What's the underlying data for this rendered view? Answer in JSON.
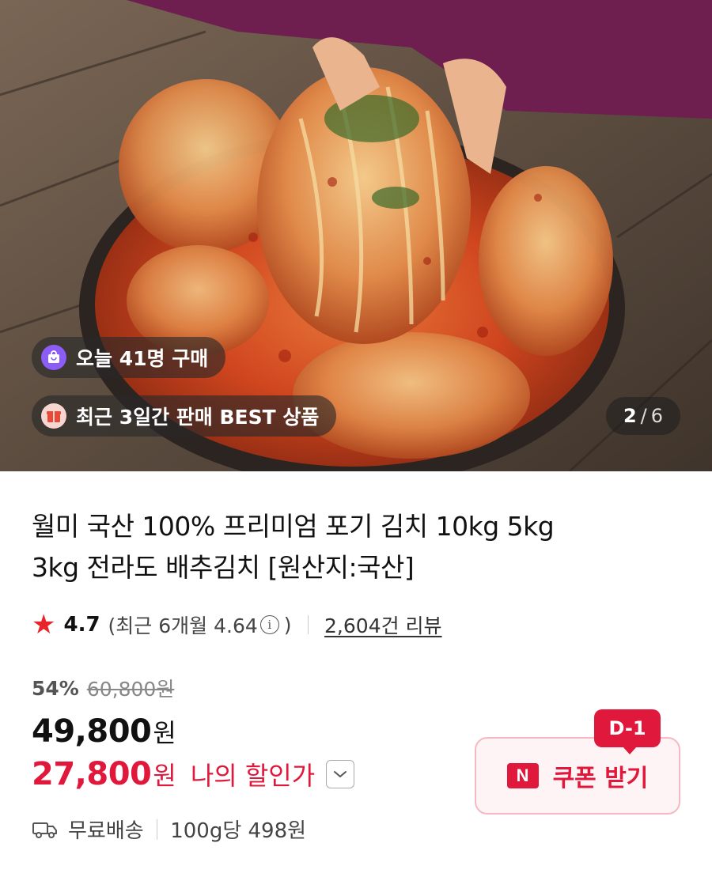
{
  "hero": {
    "image_alt": "kimchi photo",
    "badges": [
      {
        "icon": "shopping-bag-icon",
        "text": "오늘 41명 구매"
      },
      {
        "icon": "gift-box-icon",
        "text": "최근 3일간 판매 BEST 상품"
      }
    ],
    "counter": {
      "current": "2",
      "separator": "/",
      "total": "6"
    }
  },
  "product": {
    "title_line1": "월미 국산 100% 프리미엄 포기 김치 10kg 5kg",
    "title_line2": "3kg 전라도 배추김치 [원산지:국산]",
    "rating": {
      "score": "4.7",
      "recent_prefix": "(최근 6개월 4.64",
      "recent_suffix": ")",
      "info_icon": "i",
      "reviews": "2,604건 리뷰"
    },
    "discount_percent": "54%",
    "original_price": "60,800원",
    "price": "49,800",
    "price_unit": "원",
    "my_price": "27,800",
    "my_price_unit": "원",
    "my_price_label": "나의 할인가",
    "shipping": {
      "label": "무료배송",
      "unit_price": "100g당 498원"
    },
    "coupon": {
      "badge": "D-1",
      "logo": "N",
      "label": "쿠폰 받기"
    }
  },
  "colors": {
    "accent_red": "#e0183c",
    "star": "#e8242a",
    "coupon_bg": "#fff4f5",
    "coupon_border": "#f4b9c2"
  }
}
